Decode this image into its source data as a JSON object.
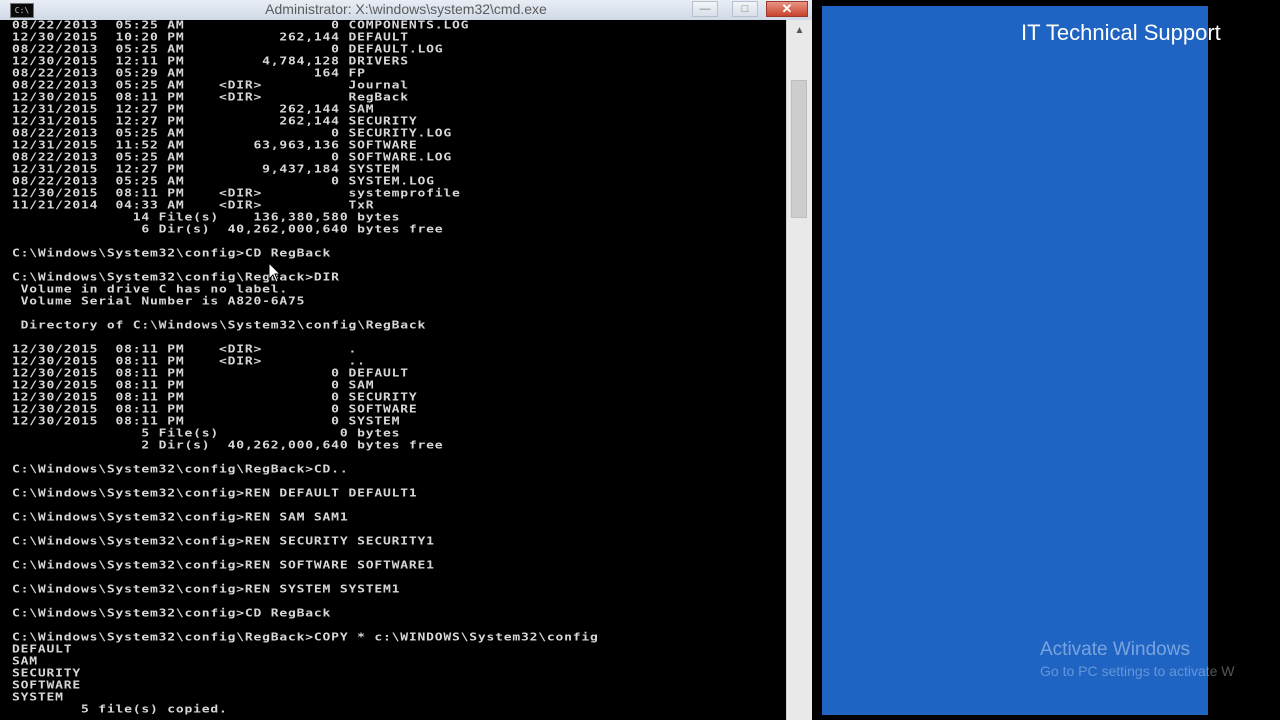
{
  "window": {
    "title": "Administrator: X:\\windows\\system32\\cmd.exe",
    "icon_text": "C:\\"
  },
  "console_lines": [
    "08/22/2013  05:25 AM                 0 COMPONENTS.LOG",
    "12/30/2015  10:20 PM           262,144 DEFAULT",
    "08/22/2013  05:25 AM                 0 DEFAULT.LOG",
    "12/30/2015  12:11 PM         4,784,128 DRIVERS",
    "08/22/2013  05:29 AM               164 FP",
    "08/22/2013  05:25 AM    <DIR>          Journal",
    "12/30/2015  08:11 PM    <DIR>          RegBack",
    "12/31/2015  12:27 PM           262,144 SAM",
    "12/31/2015  12:27 PM           262,144 SECURITY",
    "08/22/2013  05:25 AM                 0 SECURITY.LOG",
    "12/31/2015  11:52 AM        63,963,136 SOFTWARE",
    "08/22/2013  05:25 AM                 0 SOFTWARE.LOG",
    "12/31/2015  12:27 PM         9,437,184 SYSTEM",
    "08/22/2013  05:25 AM                 0 SYSTEM.LOG",
    "12/30/2015  08:11 PM    <DIR>          systemprofile",
    "11/21/2014  04:33 AM    <DIR>          TxR",
    "              14 File(s)    136,380,580 bytes",
    "               6 Dir(s)  40,262,000,640 bytes free",
    "",
    "C:\\Windows\\System32\\config>CD RegBack",
    "",
    "C:\\Windows\\System32\\config\\RegBack>DIR",
    " Volume in drive C has no label.",
    " Volume Serial Number is A820-6A75",
    "",
    " Directory of C:\\Windows\\System32\\config\\RegBack",
    "",
    "12/30/2015  08:11 PM    <DIR>          .",
    "12/30/2015  08:11 PM    <DIR>          ..",
    "12/30/2015  08:11 PM                 0 DEFAULT",
    "12/30/2015  08:11 PM                 0 SAM",
    "12/30/2015  08:11 PM                 0 SECURITY",
    "12/30/2015  08:11 PM                 0 SOFTWARE",
    "12/30/2015  08:11 PM                 0 SYSTEM",
    "               5 File(s)              0 bytes",
    "               2 Dir(s)  40,262,000,640 bytes free",
    "",
    "C:\\Windows\\System32\\config\\RegBack>CD..",
    "",
    "C:\\Windows\\System32\\config>REN DEFAULT DEFAULT1",
    "",
    "C:\\Windows\\System32\\config>REN SAM SAM1",
    "",
    "C:\\Windows\\System32\\config>REN SECURITY SECURITY1",
    "",
    "C:\\Windows\\System32\\config>REN SOFTWARE SOFTWARE1",
    "",
    "C:\\Windows\\System32\\config>REN SYSTEM SYSTEM1",
    "",
    "C:\\Windows\\System32\\config>CD RegBack",
    "",
    "C:\\Windows\\System32\\config\\RegBack>COPY * c:\\WINDOWS\\System32\\config",
    "DEFAULT",
    "SAM",
    "SECURITY",
    "SOFTWARE",
    "SYSTEM",
    "        5 file(s) copied."
  ],
  "brand": {
    "label": "IT Technical Support"
  },
  "watermark": {
    "title": "Activate Windows",
    "subtitle": "Go to PC settings to activate W"
  },
  "colors": {
    "console_bg": "#000000",
    "console_text": "#d8d8d8",
    "desktop_blue": "#1f64c3"
  }
}
